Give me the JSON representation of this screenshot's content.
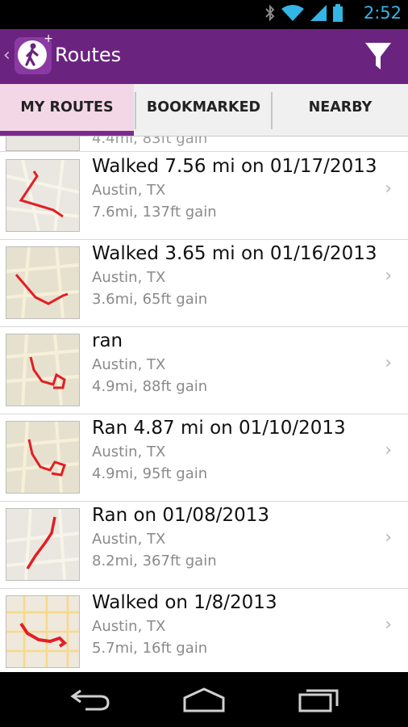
{
  "status_bar": {
    "time": "2:52",
    "icons": [
      "bluetooth-icon",
      "wifi-icon",
      "signal-icon",
      "battery-icon"
    ]
  },
  "action_bar": {
    "title": "Routes",
    "up_icon": "chevron-left-icon",
    "app_icon": "walker-icon",
    "filter_icon": "filter-icon",
    "color": "#6b2380"
  },
  "tabs": [
    {
      "label": "MY ROUTES",
      "active": true
    },
    {
      "label": "BOOKMARKED",
      "active": false
    },
    {
      "label": "NEARBY",
      "active": false
    }
  ],
  "partial_row": {
    "stats": "4.4mi, 83ft gain"
  },
  "routes": [
    {
      "title": "Walked 7.56 mi on 01/17/2013",
      "location": "Austin, TX",
      "stats": "7.6mi, 137ft gain"
    },
    {
      "title": "Walked 3.65 mi on 01/16/2013",
      "location": "Austin, TX",
      "stats": "3.6mi, 65ft gain"
    },
    {
      "title": "ran",
      "location": "Austin, TX",
      "stats": "4.9mi, 88ft gain"
    },
    {
      "title": "Ran 4.87 mi on 01/10/2013",
      "location": "Austin, TX",
      "stats": "4.9mi, 95ft gain"
    },
    {
      "title": "Ran on 01/08/2013",
      "location": "Austin, TX",
      "stats": "8.2mi, 367ft gain"
    },
    {
      "title": "Walked on 1/8/2013",
      "location": "Austin, TX",
      "stats": "5.7mi, 16ft gain"
    }
  ],
  "nav_bar": {
    "icons": [
      "back-icon",
      "home-icon",
      "recent-apps-icon"
    ]
  },
  "colors": {
    "accent": "#6b2380",
    "route_line": "#e31e24",
    "tab_active_bg": "#f4d7e6"
  }
}
